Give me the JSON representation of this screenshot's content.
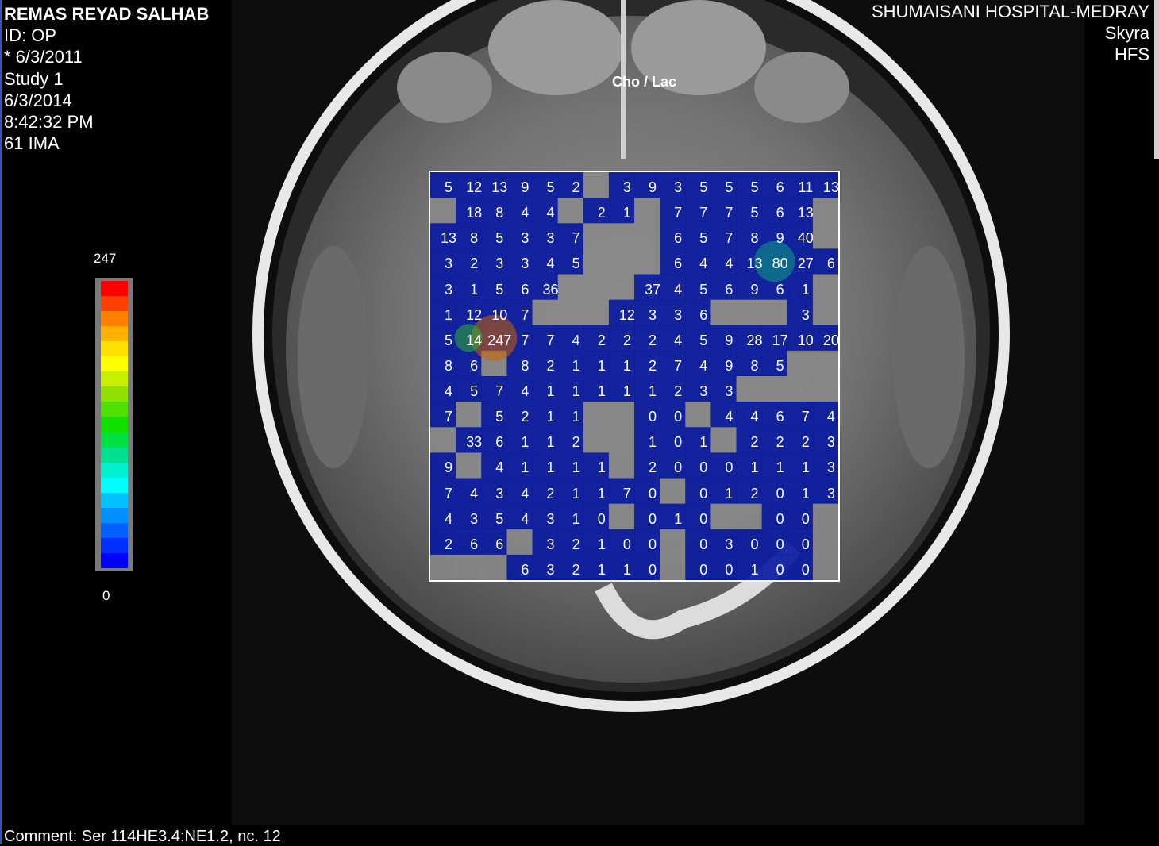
{
  "patient": {
    "name": "REMAS REYAD SALHAB",
    "id": "ID: OP",
    "dob": "* 6/3/2011",
    "study": "Study 1",
    "date": "6/3/2014",
    "time": "8:42:32 PM",
    "image": "61 IMA"
  },
  "site": {
    "hospital": "SHUMAISANI HOSPITAL-MEDRAY",
    "scanner": "Skyra",
    "position": "HFS"
  },
  "map_title": "Cho / Lac",
  "colorbar": {
    "max": "247",
    "min": "0"
  },
  "comment": "Comment: Ser 114HE3.4:NE1.2, nc. 12",
  "grid": {
    "rows": [
      [
        "5",
        "12",
        "13",
        "9",
        "5",
        "2",
        "x",
        "3",
        "9",
        "3",
        "5",
        "5",
        "5",
        "6",
        "11",
        "13"
      ],
      [
        "x",
        "18",
        "8",
        "4",
        "4",
        "x",
        "2",
        "1",
        "x",
        "7",
        "7",
        "7",
        "5",
        "6",
        "13",
        "x"
      ],
      [
        "13",
        "8",
        "5",
        "3",
        "3",
        "7",
        "x",
        "x",
        "x",
        "6",
        "5",
        "7",
        "8",
        "9",
        "40",
        "x"
      ],
      [
        "3",
        "2",
        "3",
        "3",
        "4",
        "5",
        "x",
        "x",
        "x",
        "6",
        "4",
        "4",
        "13",
        "80",
        "27",
        "6"
      ],
      [
        "3",
        "1",
        "5",
        "6",
        "36",
        "x",
        "x",
        "x",
        "37",
        "4",
        "5",
        "6",
        "9",
        "6",
        "1",
        "x"
      ],
      [
        "1",
        "12",
        "10",
        "7",
        "x",
        "x",
        "x",
        "12",
        "3",
        "3",
        "6",
        "x",
        "x",
        "x",
        "3",
        "x"
      ],
      [
        "5",
        "14",
        "247",
        "7",
        "7",
        "4",
        "2",
        "2",
        "2",
        "4",
        "5",
        "9",
        "28",
        "17",
        "10",
        "20"
      ],
      [
        "8",
        "6",
        "x",
        "8",
        "2",
        "1",
        "1",
        "1",
        "2",
        "7",
        "4",
        "9",
        "8",
        "5",
        "x",
        "x"
      ],
      [
        "4",
        "5",
        "7",
        "4",
        "1",
        "1",
        "1",
        "1",
        "1",
        "2",
        "3",
        "3",
        "x",
        "x",
        "x",
        "x"
      ],
      [
        "7",
        "x",
        "5",
        "2",
        "1",
        "1",
        "x",
        "x",
        "0",
        "0",
        "x",
        "4",
        "4",
        "6",
        "7",
        "4"
      ],
      [
        "x",
        "33",
        "6",
        "1",
        "1",
        "2",
        "x",
        "x",
        "1",
        "0",
        "1",
        "x",
        "2",
        "2",
        "2",
        "3"
      ],
      [
        "9",
        "x",
        "4",
        "1",
        "1",
        "1",
        "1",
        "x",
        "2",
        "0",
        "0",
        "0",
        "1",
        "1",
        "1",
        "3"
      ],
      [
        "7",
        "4",
        "3",
        "4",
        "2",
        "1",
        "1",
        "7",
        "0",
        "x",
        "0",
        "1",
        "2",
        "0",
        "1",
        "3"
      ],
      [
        "4",
        "3",
        "5",
        "4",
        "3",
        "1",
        "0",
        "x",
        "0",
        "1",
        "0",
        "x",
        "x",
        "0",
        "0",
        "x"
      ],
      [
        "2",
        "6",
        "6",
        "x",
        "3",
        "2",
        "1",
        "0",
        "0",
        "x",
        "0",
        "3",
        "0",
        "0",
        "0",
        "x"
      ],
      [
        "x",
        "x",
        "x",
        "6",
        "3",
        "2",
        "1",
        "1",
        "0",
        "x",
        "0",
        "0",
        "1",
        "0",
        "0",
        "x"
      ]
    ]
  },
  "colors": {
    "voxel_base": "#0a1aa0",
    "masked": "#8a8a8a",
    "colorbar": [
      "#ff0000",
      "#ff4000",
      "#ff8000",
      "#ffb000",
      "#ffe000",
      "#ffff00",
      "#c8f000",
      "#90e000",
      "#50e000",
      "#10e000",
      "#00e040",
      "#00e090",
      "#00f0d0",
      "#00ffff",
      "#00c0ff",
      "#0090ff",
      "#0060ff",
      "#0030ff",
      "#0000ff"
    ]
  }
}
